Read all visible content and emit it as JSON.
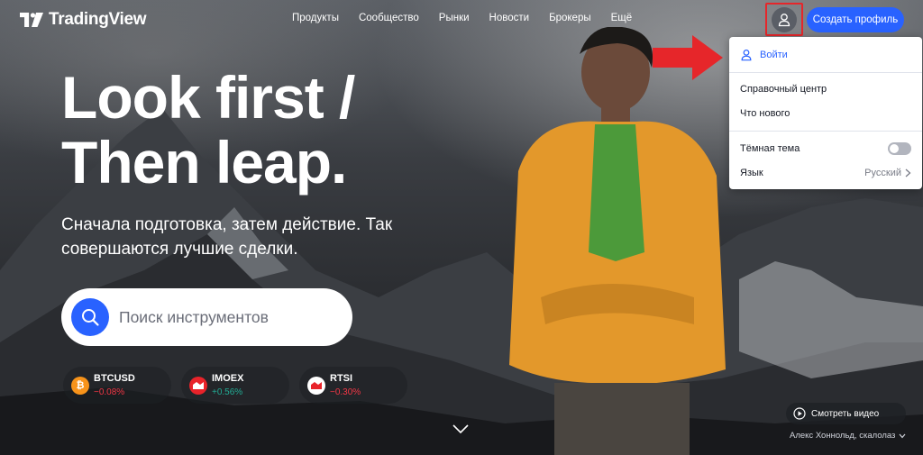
{
  "header": {
    "logo_text": "TradingView",
    "nav": [
      "Продукты",
      "Сообщество",
      "Рынки",
      "Новости",
      "Брокеры",
      "Ещё"
    ],
    "cta_label": "Создать профиль"
  },
  "dropdown": {
    "login_label": "Войти",
    "help_center": "Справочный центр",
    "whats_new": "Что нового",
    "dark_theme_label": "Тёмная тема",
    "dark_theme_on": false,
    "language_label": "Язык",
    "language_value": "Русский"
  },
  "hero": {
    "headline_line1": "Look first /",
    "headline_line2": "Then leap.",
    "subline": "Сначала подготовка, затем действие. Так совершаются лучшие сделки."
  },
  "search": {
    "placeholder": "Поиск инструментов"
  },
  "tickers": [
    {
      "symbol": "BTCUSD",
      "change": "−0.08%",
      "direction": "down",
      "icon": "bitcoin-icon",
      "color": "#f7931a"
    },
    {
      "symbol": "IMOEX",
      "change": "+0.56%",
      "direction": "up",
      "icon": "moex-icon",
      "color": "#e8232a"
    },
    {
      "symbol": "RTSI",
      "change": "−0.30%",
      "direction": "down",
      "icon": "rts-icon",
      "color": "#ffffff"
    }
  ],
  "video": {
    "watch_label": "Смотреть видео",
    "credit": "Алекс Хоннольд, скалолаз"
  },
  "colors": {
    "brand_blue": "#2962ff",
    "highlight_red": "#e6262a",
    "negative": "#f23645",
    "positive": "#22ab94"
  }
}
